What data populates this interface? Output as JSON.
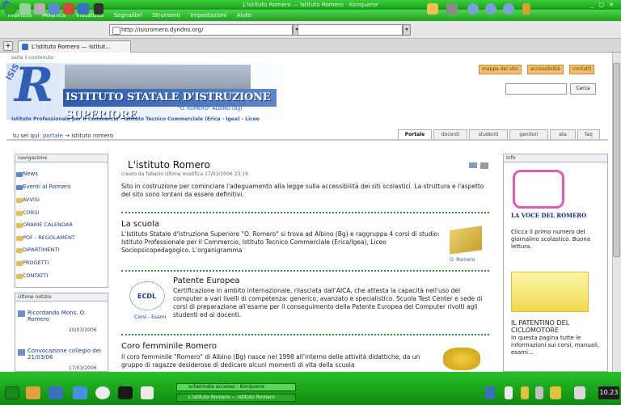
{
  "window": {
    "title": "L'istituto Romero — Istituto Romero - Konqueror",
    "menu": [
      "Indirizzo",
      "Modifica",
      "Visualizza",
      "Segnalibri",
      "Strumenti",
      "Impostazioni",
      "Aiuto"
    ]
  },
  "toolbar": {
    "url": "http://isisromero.dyndns.org/",
    "search_value": "",
    "icons": [
      "back-icon",
      "forward-icon",
      "up-icon",
      "reload-icon",
      "stop-icon",
      "home-icon",
      "bookmark-icon",
      "print-icon",
      "zoom-in-icon",
      "zoom-out-icon",
      "lock-icon"
    ]
  },
  "tabs": [
    {
      "label": "L'istituto Romero — Istitut..."
    }
  ],
  "page": {
    "skip_link": "salta il contenuto",
    "banner": {
      "isis": "ISIS",
      "letter": "R",
      "school_name": "ISTITUTO STATALE D'ISTRUZIONE SUPERIORE",
      "school_sub": "\"O. ROMERO\" ALBINO (Bg)",
      "subtitle": "Istituto Professionale per Il Commercio - Istituto Tecnico Commerciale (Erica - Igea) - Liceo"
    },
    "top_links": [
      "mappa del sito",
      "accessibilità",
      "contatti"
    ],
    "search_button": "Cerca",
    "breadcrumb": {
      "prefix": "tu sei qui:",
      "home": "portale",
      "arrow": "→",
      "current": "istituto romero"
    },
    "nav_tabs": [
      "Portale",
      "docenti",
      "studenti",
      "genitori",
      "ata",
      "faq"
    ],
    "nav_box": {
      "title": "navigazione",
      "items": [
        "News",
        "Eventi al Romero",
        "AVVISI",
        "CORSI",
        "ORARIE CALENDAR",
        "POF - REGOLAMENT",
        "DIPARTIMENTI",
        "PROGETTI",
        "CONTATTI"
      ]
    },
    "news_box": {
      "title": "Ultime notizie",
      "items": [
        {
          "title": "Ricordando Mons. O. Romero",
          "date": "20/03/2006"
        },
        {
          "title": "Convocazione collegio dei 21/03/06",
          "date": "17/03/2006"
        }
      ]
    },
    "article": {
      "title": "L'istituto Romero",
      "meta": "creato da fabazio   Ultima modifica 17/03/2006 23:19",
      "intro": "Sito in costruzione per cominciare l'adeguamento alla legge sulla accessibilità dei siti scolastici. La struttura e l'aspetto del sito sono lontani da essere definitivi.",
      "sections": [
        {
          "title": "La scuola",
          "text": "L'Istituto Statale d'Istruzione Superiore \"O. Romero\" si trova ad Albino (Bg) e raggruppa 4 corsi di studio: Istituto Professionale per il Commercio, Istituto Tecnico Commerciale (Erica/Igea), Liceo Sociopsicopedagogico. L'organigramma",
          "image_caption": "O. Romero"
        },
        {
          "title": "Patente Europea",
          "text": "Certificazione in ambito internazionale, rilasciata dall'AICA, che attesta la capacità nell'uso del computer a vari livelli di competenza: generico, avanzato e specialistico. Scuola Test Center e sede di corsi di preparazione all'esame per il conseguimento della Patente Europea del Computer rivolti agli studenti ed ai docenti.",
          "logo_text": "ECDL",
          "logo_caption": "Corsi - Esami"
        },
        {
          "title": "Coro femminile Romero",
          "text": "Il coro femminile \"Romero\" di Albino (Bg) nasce nel 1998 all'interno delle attività didattiche, da un gruppo di ragazze desiderose di dedicare alcuni momenti di vita della scuola"
        }
      ]
    },
    "right_box": {
      "title": "Info",
      "voce_logo": "LA VOCE DEL ROMERO",
      "voce_text": "Clicca il primo numero del giornalino scolastico. Buona lettura.",
      "patentino_title": "IL PATENTINO DEL CICLOMOTORE",
      "patentino_text": "In questa pagina tutte le informazioni sui corsi, manuali, esami..."
    }
  },
  "taskbar": {
    "tasks": [
      "schermata accesso - Konqueror",
      "L'istituto Romero — Istituto Romero"
    ],
    "clock": "10.23"
  },
  "colors": {
    "chrome_green": "#22a022",
    "link_blue": "#2c5cae",
    "separator_green": "#2c9a2c"
  }
}
